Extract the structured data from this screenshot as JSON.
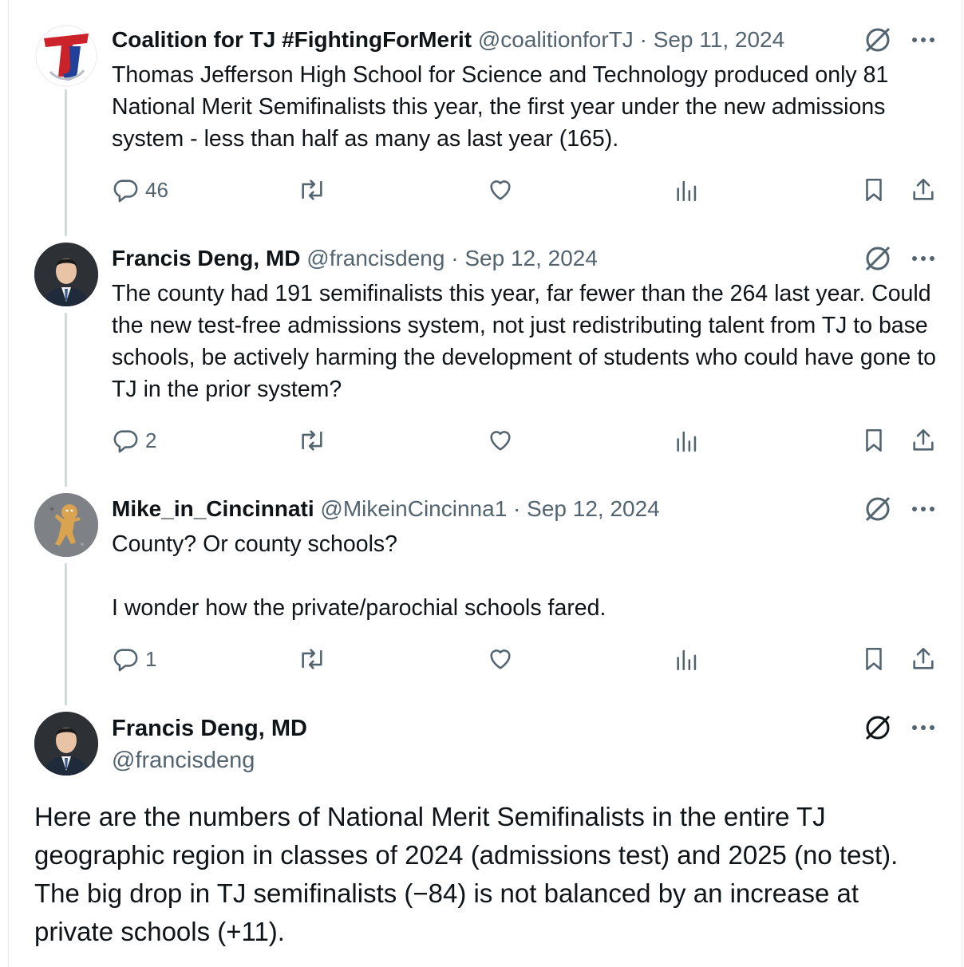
{
  "tweets": [
    {
      "name": "Coalition for TJ #FightingForMerit",
      "handle": "@coalitionforTJ",
      "separator": "·",
      "date": "Sep 11, 2024",
      "text": [
        "Thomas Jefferson High School for Science and Technology produced only 81 National Merit Semifinalists this year, the first year under the new admissions system - less than half as many as last year (165)."
      ],
      "reply_count": "46",
      "avatar_icon": "tj-logo-icon"
    },
    {
      "name": "Francis Deng, MD",
      "handle": "@francisdeng",
      "separator": "·",
      "date": "Sep 12, 2024",
      "text": [
        "The county had 191 semifinalists this year, far fewer than the 264 last year. Could the new test-free admissions system, not just redistributing talent from TJ to base schools, be actively harming the development of students who could have gone to TJ in the prior system?"
      ],
      "reply_count": "2",
      "avatar_icon": "person-photo-avatar"
    },
    {
      "name": "Mike_in_Cincinnati",
      "handle": "@MikeinCincinna1",
      "separator": "·",
      "date": "Sep 12, 2024",
      "text": [
        "County? Or county schools?",
        "I wonder how the private/parochial schools fared."
      ],
      "reply_count": "1",
      "avatar_icon": "gingerbread-avatar"
    }
  ],
  "main_tweet": {
    "name": "Francis Deng, MD",
    "handle": "@francisdeng",
    "text": "Here are the numbers of National Merit Semifinalists in the entire TJ geographic region in classes of 2024 (admissions test) and 2025 (no test). The big drop in TJ semifinalists (−84) is not balanced by an increase at private schools (+11)."
  },
  "icons": {
    "reply": "reply-icon",
    "retweet": "retweet-icon",
    "like": "like-icon",
    "views": "views-icon",
    "bookmark": "bookmark-icon",
    "share": "share-icon",
    "grok": "grok-icon",
    "more": "more-icon"
  },
  "colors": {
    "text": "#0f1419",
    "secondary": "#536471",
    "thread_line": "#cfd9de"
  }
}
